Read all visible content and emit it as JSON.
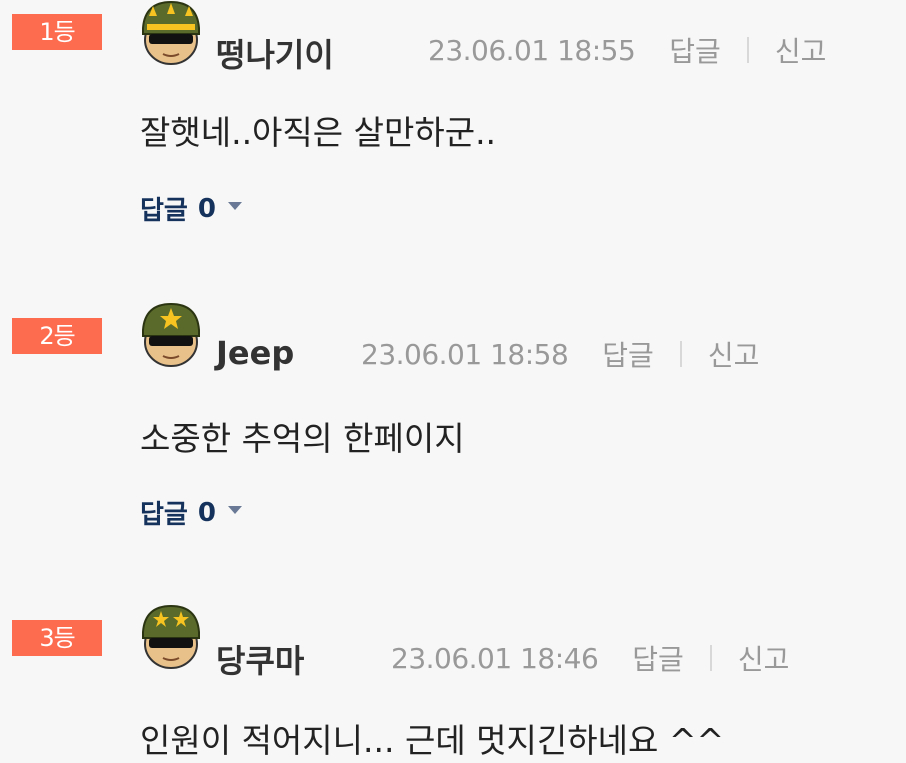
{
  "comments": [
    {
      "rank": "1등",
      "nickname": "떵나기이",
      "date": "23.06.01 18:55",
      "reply_action": "답글",
      "report_action": "신고",
      "body": "잘햇네..아직은 살만하군..",
      "reply_label": "답글",
      "reply_count": "0",
      "avatar_icon": "soldier-avatar-three-stars"
    },
    {
      "rank": "2등",
      "nickname": "Jeep",
      "date": "23.06.01 18:58",
      "reply_action": "답글",
      "report_action": "신고",
      "body": "소중한 추억의 한페이지",
      "reply_label": "답글",
      "reply_count": "0",
      "avatar_icon": "soldier-avatar-one-star"
    },
    {
      "rank": "3등",
      "nickname": "당쿠마",
      "date": "23.06.01 18:46",
      "reply_action": "답글",
      "report_action": "신고",
      "body": "인원이 적어지니... 근데 멋지긴하네요 ^^",
      "avatar_icon": "soldier-avatar-two-stars"
    }
  ],
  "colors": {
    "rank_badge": "#fe6c4f",
    "reply_toggle": "#14325c",
    "meta": "#999999"
  }
}
